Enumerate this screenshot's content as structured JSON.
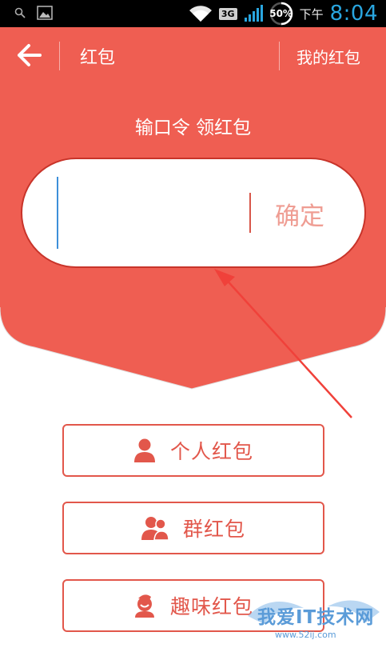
{
  "status_bar": {
    "network": "3G",
    "battery": "50%",
    "ampm": "下午",
    "time": "8:04",
    "icons": [
      "search-icon",
      "image-icon",
      "wifi-icon",
      "signal-icon",
      "battery-ring-icon"
    ]
  },
  "header": {
    "back_icon": "arrow-left-icon",
    "title": "红包",
    "right_link": "我的红包"
  },
  "redeem": {
    "subtitle": "输口令 领红包",
    "input_value": "",
    "input_placeholder": "",
    "confirm_label": "确定"
  },
  "options": [
    {
      "label": "个人红包",
      "icon": "person-icon"
    },
    {
      "label": "群红包",
      "icon": "group-icon"
    },
    {
      "label": "趣味红包",
      "icon": "fun-face-icon"
    }
  ],
  "watermark": {
    "text": "我爱IT技术网",
    "site": "www.52ij.com"
  },
  "colors": {
    "header_red": "#ef5e52",
    "accent_red": "#e2574b",
    "confirm_text": "#ef9d93",
    "time_blue": "#29a6e0",
    "annotation_arrow": "#f0413a"
  }
}
